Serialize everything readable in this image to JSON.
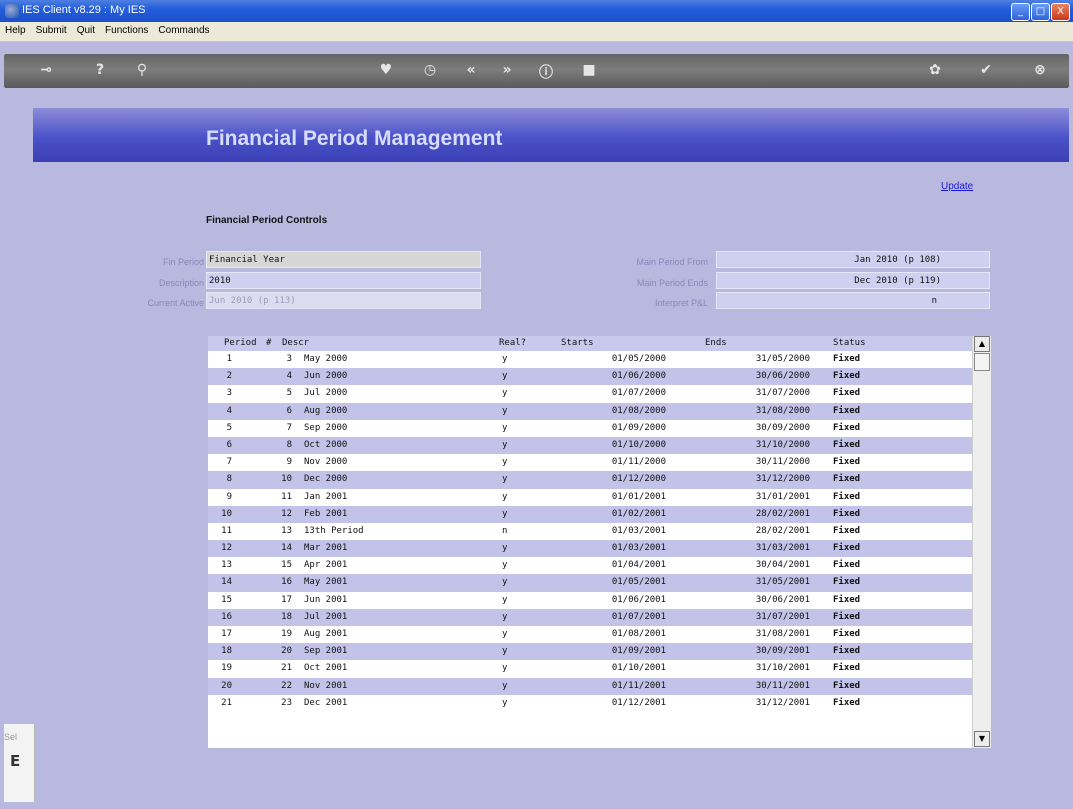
{
  "window": {
    "title": "IES Client v8.29 : My IES",
    "min": "_",
    "max": "□",
    "close": "X"
  },
  "menu": [
    "Help",
    "Submit",
    "Quit",
    "Functions",
    "Commands"
  ],
  "toolbar_icons": [
    "back-key-icon",
    "help-icon",
    "search-icon",
    "heart-icon",
    "clock-icon",
    "rewind-icon",
    "fast-forward-icon",
    "info-icon",
    "stop-icon",
    "palette-icon",
    "check-icon",
    "close-icon"
  ],
  "banner": {
    "title": "Financial Period Management"
  },
  "update_link": "Update",
  "section_title": "Financial Period Controls",
  "form": {
    "fin_period": {
      "label": "Fin Period",
      "value": "Financial Year"
    },
    "description": {
      "label": "Description",
      "value": "2010"
    },
    "current_active": {
      "label": "Current Active",
      "value": "Jun 2010 (p 113)"
    },
    "main_period_from": {
      "label": "Main Period From",
      "value": "Jan 2010 (p 108)"
    },
    "main_period_ends": {
      "label": "Main Period Ends",
      "value": "Dec 2010 (p 119)"
    },
    "interpret_pl": {
      "label": "Interpret P&L",
      "value": "n"
    }
  },
  "table": {
    "headers": {
      "period": "Period",
      "num": "#",
      "descr": "Descr",
      "real": "Real?",
      "starts": "Starts",
      "ends": "Ends",
      "status": "Status"
    },
    "rows": [
      [
        "1",
        "3",
        "May 2000",
        "y",
        "01/05/2000",
        "31/05/2000",
        "Fixed"
      ],
      [
        "2",
        "4",
        "Jun 2000",
        "y",
        "01/06/2000",
        "30/06/2000",
        "Fixed"
      ],
      [
        "3",
        "5",
        "Jul 2000",
        "y",
        "01/07/2000",
        "31/07/2000",
        "Fixed"
      ],
      [
        "4",
        "6",
        "Aug 2000",
        "y",
        "01/08/2000",
        "31/08/2000",
        "Fixed"
      ],
      [
        "5",
        "7",
        "Sep 2000",
        "y",
        "01/09/2000",
        "30/09/2000",
        "Fixed"
      ],
      [
        "6",
        "8",
        "Oct 2000",
        "y",
        "01/10/2000",
        "31/10/2000",
        "Fixed"
      ],
      [
        "7",
        "9",
        "Nov 2000",
        "y",
        "01/11/2000",
        "30/11/2000",
        "Fixed"
      ],
      [
        "8",
        "10",
        "Dec 2000",
        "y",
        "01/12/2000",
        "31/12/2000",
        "Fixed"
      ],
      [
        "9",
        "11",
        "Jan 2001",
        "y",
        "01/01/2001",
        "31/01/2001",
        "Fixed"
      ],
      [
        "10",
        "12",
        "Feb 2001",
        "y",
        "01/02/2001",
        "28/02/2001",
        "Fixed"
      ],
      [
        "11",
        "13",
        "13th Period",
        "n",
        "01/03/2001",
        "28/02/2001",
        "Fixed"
      ],
      [
        "12",
        "14",
        "Mar 2001",
        "y",
        "01/03/2001",
        "31/03/2001",
        "Fixed"
      ],
      [
        "13",
        "15",
        "Apr 2001",
        "y",
        "01/04/2001",
        "30/04/2001",
        "Fixed"
      ],
      [
        "14",
        "16",
        "May 2001",
        "y",
        "01/05/2001",
        "31/05/2001",
        "Fixed"
      ],
      [
        "15",
        "17",
        "Jun 2001",
        "y",
        "01/06/2001",
        "30/06/2001",
        "Fixed"
      ],
      [
        "16",
        "18",
        "Jul 2001",
        "y",
        "01/07/2001",
        "31/07/2001",
        "Fixed"
      ],
      [
        "17",
        "19",
        "Aug 2001",
        "y",
        "01/08/2001",
        "31/08/2001",
        "Fixed"
      ],
      [
        "18",
        "20",
        "Sep 2001",
        "y",
        "01/09/2001",
        "30/09/2001",
        "Fixed"
      ],
      [
        "19",
        "21",
        "Oct 2001",
        "y",
        "01/10/2001",
        "31/10/2001",
        "Fixed"
      ],
      [
        "20",
        "22",
        "Nov 2001",
        "y",
        "01/11/2001",
        "30/11/2001",
        "Fixed"
      ],
      [
        "21",
        "23",
        "Dec 2001",
        "y",
        "01/12/2001",
        "31/12/2001",
        "Fixed"
      ]
    ]
  },
  "side_panel": {
    "sel": "Sel",
    "letter": "E"
  }
}
